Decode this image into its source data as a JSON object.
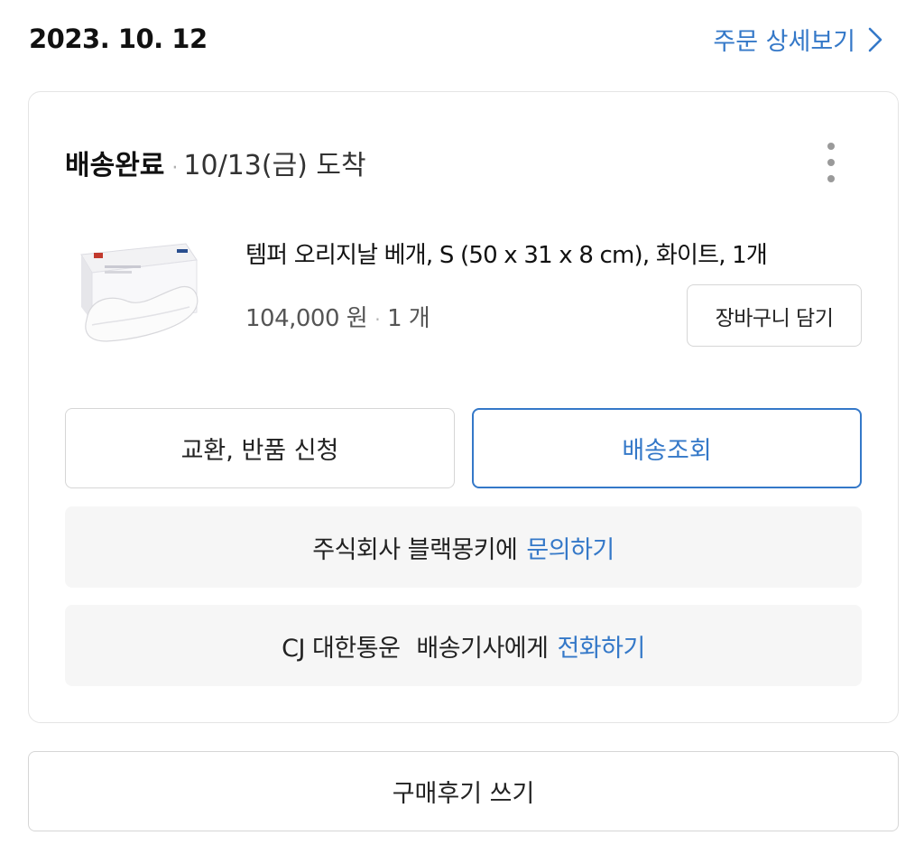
{
  "order": {
    "date": "2023. 10. 12",
    "detail_link_label": "주문 상세보기"
  },
  "shipment": {
    "status": "배송완료",
    "arrival": "10/13(금) 도착",
    "product": {
      "name": "템퍼 오리지날 베개, S (50 x 31 x 8 cm), 화이트, 1개",
      "price": "104,000 원",
      "quantity": "1 개",
      "thumbnail_icon": "pillow-image"
    },
    "cart_button_label": "장바구니 담기",
    "exchange_button_label": "교환, 반품 신청",
    "tracking_button_label": "배송조회",
    "seller_inquiry": {
      "text": "주식회사 블랙몽키에",
      "link": "문의하기"
    },
    "courier_contact": {
      "courier": "CJ 대한통운",
      "text": "배송기사에게",
      "link": "전화하기"
    }
  },
  "review_button_label": "구매후기 쓰기",
  "colors": {
    "accent": "#3478c8",
    "border": "#d6d6d6",
    "info_bg": "#f6f6f6"
  }
}
